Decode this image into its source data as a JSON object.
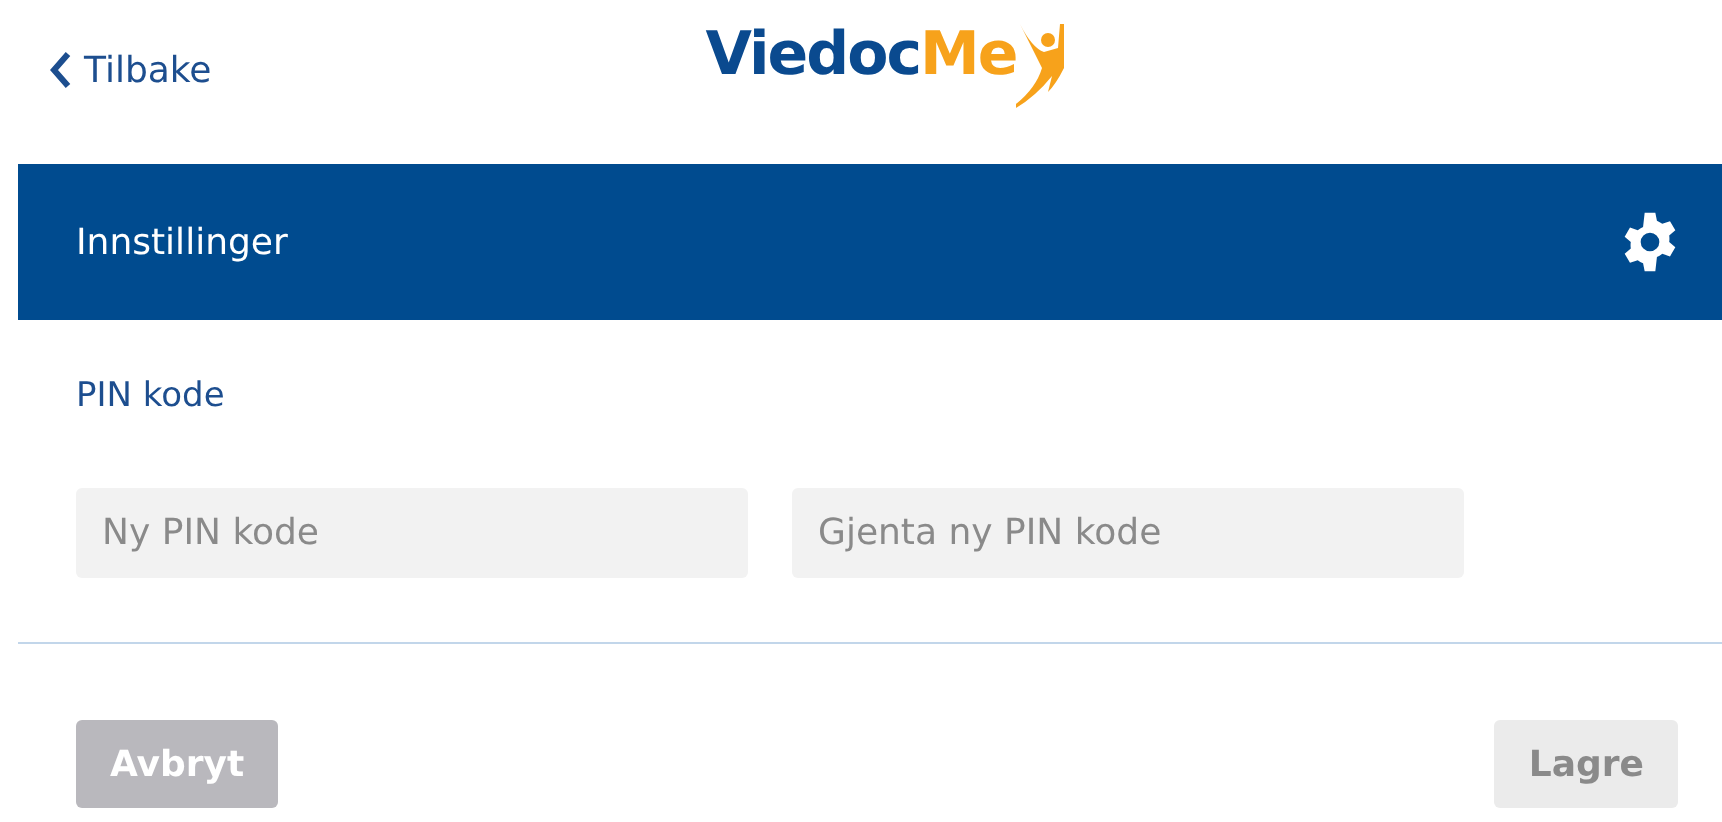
{
  "header": {
    "back_link": "Tilbake",
    "logo": {
      "primary": "Viedoc",
      "accent": "Me"
    }
  },
  "panel": {
    "title": "Innstillinger"
  },
  "section": {
    "title": "PIN kode"
  },
  "fields": [
    {
      "placeholder": "Ny PIN kode"
    },
    {
      "placeholder": "Gjenta ny PIN kode"
    }
  ],
  "buttons": [
    {
      "label": "Avbryt",
      "kind": "cancel",
      "disabled": false
    },
    {
      "label": "Lagre",
      "kind": "save",
      "disabled": true
    }
  ]
}
